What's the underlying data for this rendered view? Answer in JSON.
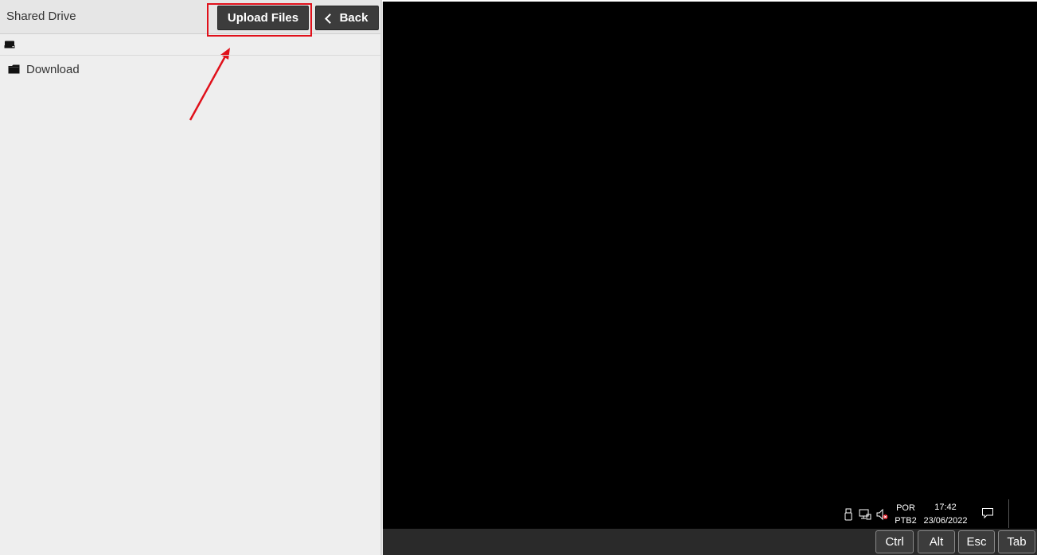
{
  "header": {
    "title": "Shared Drive",
    "upload_label": "Upload Files",
    "back_label": "Back"
  },
  "path_bar": {
    "icon": "drive-icon"
  },
  "files": [
    {
      "name": "Download",
      "icon": "folder-icon"
    }
  ],
  "annotation": {
    "highlight_color": "#e0101a",
    "target": "Upload Files"
  },
  "remote_tray": {
    "icons": [
      "usb-icon",
      "network-icon",
      "volume-muted-icon"
    ],
    "language_top": "POR",
    "language_bottom": "PTB2",
    "time": "17:42",
    "date": "23/06/2022",
    "notification_icon": "notification-icon"
  },
  "keys": [
    "Ctrl",
    "Alt",
    "Esc",
    "Tab"
  ],
  "colors": {
    "panel_bg": "#eeeeee",
    "button_bg": "#3c3c3c",
    "remote_bg": "#000000"
  }
}
